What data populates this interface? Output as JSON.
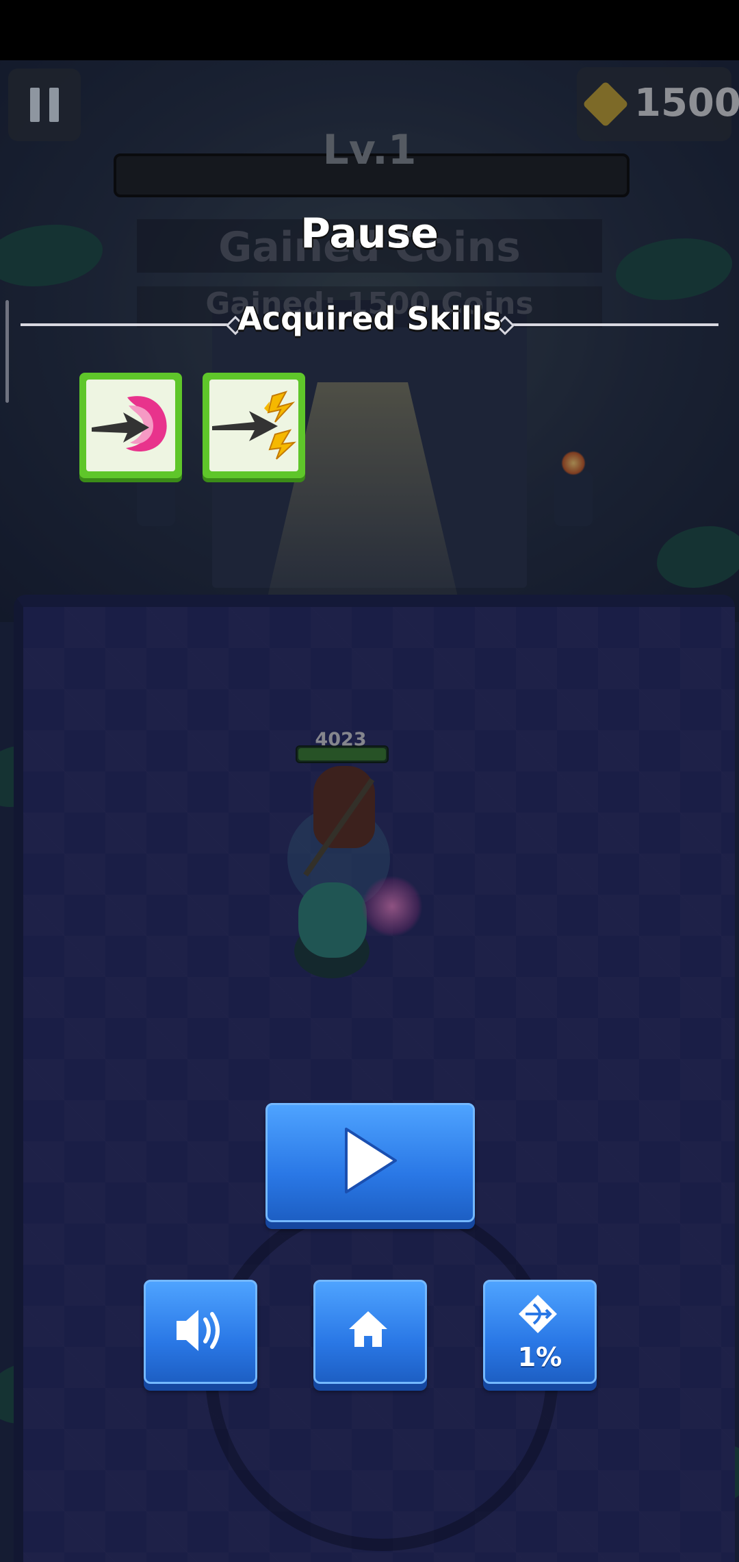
{
  "hud": {
    "coins": "1500",
    "level": "Lv.1"
  },
  "background_text": {
    "gained_coins_title": "Gained Coins",
    "gained_coins_amount": "Gained: 1500 Coins"
  },
  "character": {
    "hp": "4023"
  },
  "pause_menu": {
    "title": "Pause",
    "skills_heading": "Acquired Skills",
    "skills": [
      {
        "name": "pink-arrow-skill-icon"
      },
      {
        "name": "lightning-arrow-skill-icon"
      }
    ],
    "buttons": {
      "resume": "play-icon",
      "sound": "speaker-icon",
      "home": "home-icon",
      "bow_progress": "1%"
    }
  },
  "colors": {
    "button_blue": "#2a78e6",
    "skill_green": "#5fc62a",
    "text_white": "#ffffff"
  }
}
